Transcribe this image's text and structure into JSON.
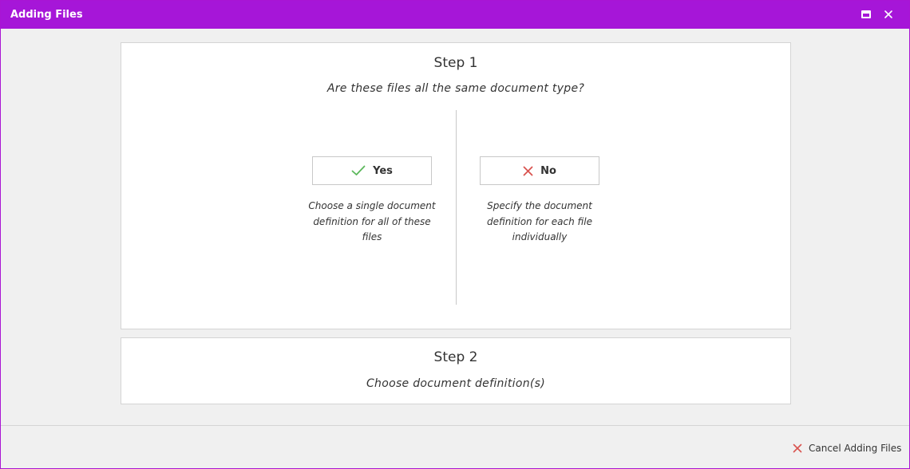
{
  "window": {
    "title": "Adding Files",
    "maximize_icon": "maximize-icon",
    "close_icon": "close-icon",
    "accent_color": "#a616d8"
  },
  "step1": {
    "title": "Step 1",
    "question": "Are these files all the same document type?",
    "yes": {
      "label": "Yes",
      "icon": "check-icon",
      "icon_color": "#5cb85c",
      "description": "Choose a single document definition for all of these files"
    },
    "no": {
      "label": "No",
      "icon": "x-icon",
      "icon_color": "#d9534f",
      "description": "Specify the document definition for each file individually"
    }
  },
  "step2": {
    "title": "Step 2",
    "subtitle": "Choose document definition(s)"
  },
  "footer": {
    "cancel_label": "Cancel Adding Files",
    "cancel_icon": "x-icon",
    "cancel_icon_color": "#d9534f"
  }
}
